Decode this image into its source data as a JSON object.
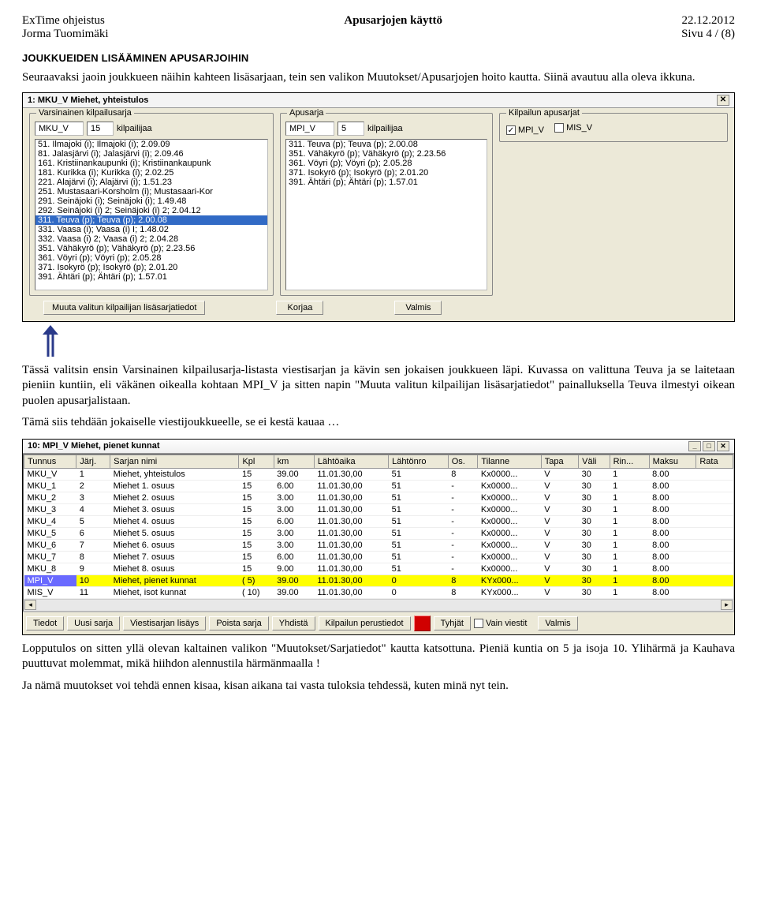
{
  "header": {
    "left": "ExTime ohjeistus",
    "center": "Apusarjojen käyttö",
    "right": "22.12.2012",
    "author": "Jorma Tuomimäki",
    "page": "Sivu 4 / (8)"
  },
  "section_title": "JOUKKUEIDEN LISÄÄMINEN APUSARJOIHIN",
  "para1": "Seuraavaksi jaoin joukkueen näihin kahteen lisäsarjaan, tein sen valikon Muutokset/Apusarjojen hoito kautta. Siinä avautuu alla oleva ikkuna.",
  "winA": {
    "title": "1: MKU_V Miehet, yhteistulos",
    "groupA_label": "Varsinainen kilpailusarja",
    "groupB_label": "Apusarja",
    "groupC_label": "Kilpailun apusarjat",
    "groupA_code": "MKU_V",
    "groupA_count": "15",
    "groupA_suffix": "kilpailijaa",
    "groupB_code": "MPI_V",
    "groupB_count": "5",
    "groupB_suffix": "kilpailijaa",
    "chk1_label": "MPI_V",
    "chk1_checked": "✓",
    "chk2_label": "MIS_V",
    "listA": [
      "51. Ilmajoki (i); Ilmajoki (i); 2.09.09",
      "81. Jalasjärvi (i); Jalasjärvi (i); 2.09.46",
      "161. Kristiinankaupunki (i); Kristiinankaupunk",
      "181. Kurikka (i); Kurikka (i); 2.02.25",
      "221. Alajärvi (i); Alajärvi (i); 1.51.23",
      "251. Mustasaari-Korsholm (i); Mustasaari-Kor",
      "291. Seinäjoki (i); Seinäjoki (i); 1.49.48",
      "292. Seinäjoki (i) 2; Seinäjoki (i) 2; 2.04.12",
      "311. Teuva (p); Teuva (p); 2.00.08",
      "331. Vaasa (i); Vaasa (i) I; 1.48.02",
      "332. Vaasa (i) 2; Vaasa (i) 2; 2.04.28",
      "351. Vähäkyrö (p); Vähäkyrö (p); 2.23.56",
      "361. Vöyri (p); Vöyri (p); 2.05.28",
      "371. Isokyrö (p); Isokyrö (p); 2.01.20",
      "391. Ähtäri (p); Ähtäri (p); 1.57.01"
    ],
    "listA_selected_index": 8,
    "listB": [
      "311. Teuva (p); Teuva (p); 2.00.08",
      "351. Vähäkyrö (p); Vähäkyrö (p); 2.23.56",
      "361. Vöyri (p); Vöyri (p); 2.05.28",
      "371. Isokyrö (p); Isokyrö (p); 2.01.20",
      "391. Ähtäri (p); Ähtäri (p); 1.57.01"
    ],
    "btn_muuta": "Muuta valitun kilpailijan lisäsarjatiedot",
    "btn_korjaa": "Korjaa",
    "btn_valmis": "Valmis"
  },
  "para2": "Tässä valitsin ensin Varsinainen kilpailusarja-listasta viestisarjan ja kävin sen jokaisen joukkueen läpi. Kuvassa on valittuna Teuva ja se laitetaan pieniin kuntiin, eli väkänen oikealla kohtaan MPI_V ja sitten napin \"Muuta valitun kilpailijan lisäsarjatiedot\" painalluksella Teuva ilmestyi oikean puolen apusarjalistaan.",
  "para3": "Tämä siis tehdään jokaiselle viestijoukkueelle, se ei kestä kauaa …",
  "winB": {
    "title": "10: MPI_V Miehet, pienet kunnat",
    "columns": [
      "Tunnus",
      "Järj.",
      "Sarjan nimi",
      "Kpl",
      "km",
      "Lähtöaika",
      "Lähtönro",
      "Os.",
      "Tilanne",
      "Tapa",
      "Väli",
      "Rin...",
      "Maksu",
      "Rata"
    ],
    "rows": [
      {
        "c": [
          "MKU_V",
          "1",
          "Miehet, yhteistulos",
          "15",
          "39.00",
          "11.01.30,00",
          "51",
          "8",
          "Kx0000...",
          "V",
          "30",
          "1",
          "8.00",
          ""
        ]
      },
      {
        "c": [
          "MKU_1",
          "2",
          "Miehet 1. osuus",
          "15",
          "6.00",
          "11.01.30,00",
          "51",
          "-",
          "Kx0000...",
          "V",
          "30",
          "1",
          "8.00",
          ""
        ]
      },
      {
        "c": [
          "MKU_2",
          "3",
          "Miehet 2. osuus",
          "15",
          "3.00",
          "11.01.30,00",
          "51",
          "-",
          "Kx0000...",
          "V",
          "30",
          "1",
          "8.00",
          ""
        ]
      },
      {
        "c": [
          "MKU_3",
          "4",
          "Miehet 3. osuus",
          "15",
          "3.00",
          "11.01.30,00",
          "51",
          "-",
          "Kx0000...",
          "V",
          "30",
          "1",
          "8.00",
          ""
        ]
      },
      {
        "c": [
          "MKU_4",
          "5",
          "Miehet 4. osuus",
          "15",
          "6.00",
          "11.01.30,00",
          "51",
          "-",
          "Kx0000...",
          "V",
          "30",
          "1",
          "8.00",
          ""
        ]
      },
      {
        "c": [
          "MKU_5",
          "6",
          "Miehet 5. osuus",
          "15",
          "3.00",
          "11.01.30,00",
          "51",
          "-",
          "Kx0000...",
          "V",
          "30",
          "1",
          "8.00",
          ""
        ]
      },
      {
        "c": [
          "MKU_6",
          "7",
          "Miehet 6. osuus",
          "15",
          "3.00",
          "11.01.30,00",
          "51",
          "-",
          "Kx0000...",
          "V",
          "30",
          "1",
          "8.00",
          ""
        ]
      },
      {
        "c": [
          "MKU_7",
          "8",
          "Miehet 7. osuus",
          "15",
          "6.00",
          "11.01.30,00",
          "51",
          "-",
          "Kx0000...",
          "V",
          "30",
          "1",
          "8.00",
          ""
        ]
      },
      {
        "c": [
          "MKU_8",
          "9",
          "Miehet 8. osuus",
          "15",
          "9.00",
          "11.01.30,00",
          "51",
          "-",
          "Kx0000...",
          "V",
          "30",
          "1",
          "8.00",
          ""
        ]
      },
      {
        "c": [
          "MPI_V",
          "10",
          "Miehet, pienet kunnat",
          "(  5)",
          "39.00",
          "11.01.30,00",
          "0",
          "8",
          "KYx000...",
          "V",
          "30",
          "1",
          "8.00",
          ""
        ],
        "hl": true
      },
      {
        "c": [
          "MIS_V",
          "11",
          "Miehet, isot kunnat",
          "( 10)",
          "39.00",
          "11.01.30,00",
          "0",
          "8",
          "KYx000...",
          "V",
          "30",
          "1",
          "8.00",
          ""
        ]
      }
    ],
    "buttons": {
      "tiedot": "Tiedot",
      "uusi": "Uusi sarja",
      "viesti": "Viestisarjan lisäys",
      "poista": "Poista sarja",
      "yhdista": "Yhdistä",
      "perus": "Kilpailun perustiedot",
      "tyhjat": "Tyhjät",
      "vain": "Vain viestit",
      "valmis": "Valmis"
    }
  },
  "para4": "Lopputulos on sitten yllä olevan kaltainen valikon \"Muutokset/Sarjatiedot\" kautta katsottuna. Pieniä kuntia on 5 ja isoja 10. Ylihärmä ja Kauhava puuttuvat molemmat, mikä hiihdon alennustila härmänmaalla !",
  "para5": "Ja nämä muutokset voi tehdä ennen kisaa, kisan aikana tai vasta tuloksia tehdessä, kuten minä nyt tein."
}
